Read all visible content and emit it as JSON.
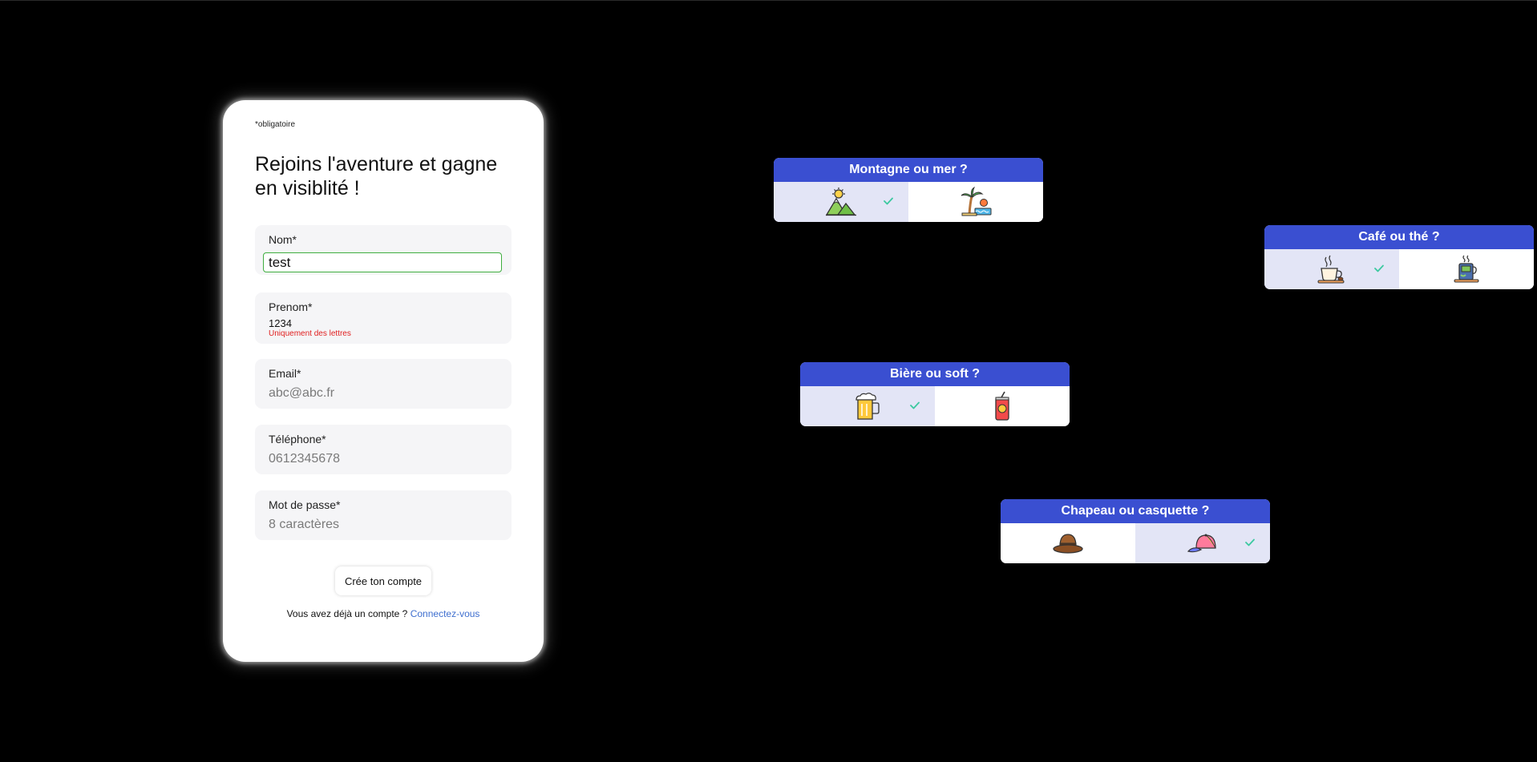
{
  "form": {
    "required_note": "*obligatoire",
    "title": "Rejoins l'aventure et gagne en visiblité !",
    "fields": [
      {
        "label": "Nom*",
        "value": "test",
        "placeholder": ""
      },
      {
        "label": "Prenom*",
        "value": "1234",
        "placeholder": "",
        "error": "Uniquement des lettres"
      },
      {
        "label": "Email*",
        "value": "",
        "placeholder": "abc@abc.fr"
      },
      {
        "label": "Téléphone*",
        "value": "",
        "placeholder": "0612345678"
      },
      {
        "label": "Mot de passe*",
        "value": "",
        "placeholder": "8 caractères"
      }
    ],
    "submit_label": "Crée ton compte",
    "login_prompt": "Vous avez déjà un compte ?",
    "login_link": "Connectez-vous"
  },
  "choices": [
    {
      "question": "Montagne ou mer ?",
      "left_icon": "mountain-icon",
      "right_icon": "beach-icon",
      "selected": "left"
    },
    {
      "question": "Café ou thé ?",
      "left_icon": "coffee-cup-icon",
      "right_icon": "tea-icon",
      "selected": "left"
    },
    {
      "question": "Bière ou soft ?",
      "left_icon": "beer-icon",
      "right_icon": "soda-icon",
      "selected": "left"
    },
    {
      "question": "Chapeau ou casquette ?",
      "left_icon": "hat-icon",
      "right_icon": "cap-icon",
      "selected": "right"
    }
  ],
  "colors": {
    "background": "#000000",
    "header_blue": "#3a4fd1",
    "selected_bg": "#e3e5f6",
    "check_green": "#3cc9a0",
    "error_red": "#e02020",
    "link_blue": "#3f6fcf",
    "active_border": "#3fae3f"
  }
}
